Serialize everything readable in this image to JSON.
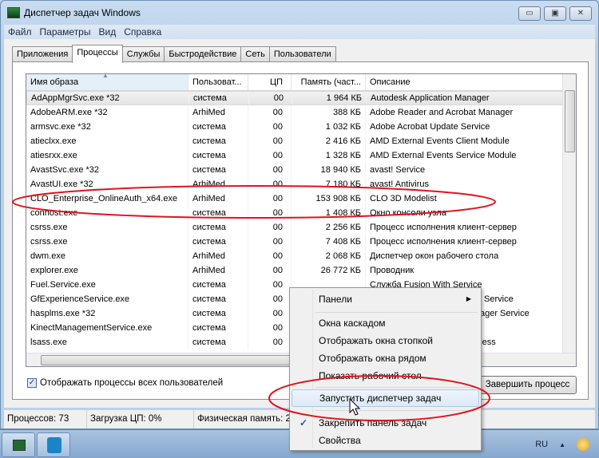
{
  "window": {
    "title": "Диспетчер задач Windows",
    "minimize": "▭",
    "maximize": "▣",
    "close": "✕"
  },
  "menu": [
    "Файл",
    "Параметры",
    "Вид",
    "Справка"
  ],
  "tabs": [
    "Приложения",
    "Процессы",
    "Службы",
    "Быстродействие",
    "Сеть",
    "Пользователи"
  ],
  "columns": [
    "Имя образа",
    "Пользоват...",
    "ЦП",
    "Память (част...",
    "Описание"
  ],
  "rows": [
    [
      "AdAppMgrSvc.exe *32",
      "система",
      "00",
      "1 964 КБ",
      "Autodesk Application Manager"
    ],
    [
      "AdobeARM.exe *32",
      "ArhiMed",
      "00",
      "388 КБ",
      "Adobe Reader and Acrobat Manager"
    ],
    [
      "armsvc.exe *32",
      "система",
      "00",
      "1 032 КБ",
      "Adobe Acrobat Update Service"
    ],
    [
      "atieclxx.exe",
      "система",
      "00",
      "2 416 КБ",
      "AMD External Events Client Module"
    ],
    [
      "atiesrxx.exe",
      "система",
      "00",
      "1 328 КБ",
      "AMD External Events Service Module"
    ],
    [
      "AvastSvc.exe *32",
      "система",
      "00",
      "18 940 КБ",
      "avast! Service"
    ],
    [
      "AvastUI.exe *32",
      "ArhiMed",
      "00",
      "7 180 КБ",
      "avast! Antivirus"
    ],
    [
      "CLO_Enterprise_OnlineAuth_x64.exe",
      "ArhiMed",
      "00",
      "153 908 КБ",
      "CLO 3D Modelist"
    ],
    [
      "conhost.exe",
      "система",
      "00",
      "1 408 КБ",
      "Окно консоли узла"
    ],
    [
      "csrss.exe",
      "система",
      "00",
      "2 256 КБ",
      "Процесс исполнения клиент-сервер"
    ],
    [
      "csrss.exe",
      "система",
      "00",
      "7 408 КБ",
      "Процесс исполнения клиент-сервер"
    ],
    [
      "dwm.exe",
      "ArhiMed",
      "00",
      "2 068 КБ",
      "Диспетчер окон рабочего стола"
    ],
    [
      "explorer.exe",
      "ArhiMed",
      "00",
      "26 772 КБ",
      "Проводник"
    ],
    [
      "Fuel.Service.exe",
      "система",
      "00",
      "",
      "Служба Fusion With Service"
    ],
    [
      "GfExperienceService.exe",
      "система",
      "00",
      "",
      "NVIDIA GeForce Experience Service"
    ],
    [
      "hasplms.exe *32",
      "система",
      "00",
      "",
      "Sentinel HASP License Manager Service"
    ],
    [
      "KinectManagementService.exe",
      "система",
      "00",
      "",
      ""
    ],
    [
      "lsass.exe",
      "система",
      "00",
      "",
      "Local Security Authority Process"
    ]
  ],
  "show_all_users": {
    "label": "Отображать процессы всех пользователей",
    "checked": true,
    "mark": "✓"
  },
  "end_process": "Завершить процесс",
  "status": [
    "Процессов: 73",
    "Загрузка ЦП: 0%",
    "Физическая память: 2"
  ],
  "context_menu": {
    "items": [
      "Панели",
      "Окна каскадом",
      "Отображать окна стопкой",
      "Отображать окна рядом",
      "Показать рабочий стол",
      "Запустить диспетчер задач",
      "Закрепить панель задач",
      "Свойства"
    ],
    "submenu_arrow": "▶",
    "check": "✓"
  },
  "tray": {
    "lang": "RU",
    "up": "▲"
  },
  "colors": {
    "annotation": "#e0141e"
  }
}
